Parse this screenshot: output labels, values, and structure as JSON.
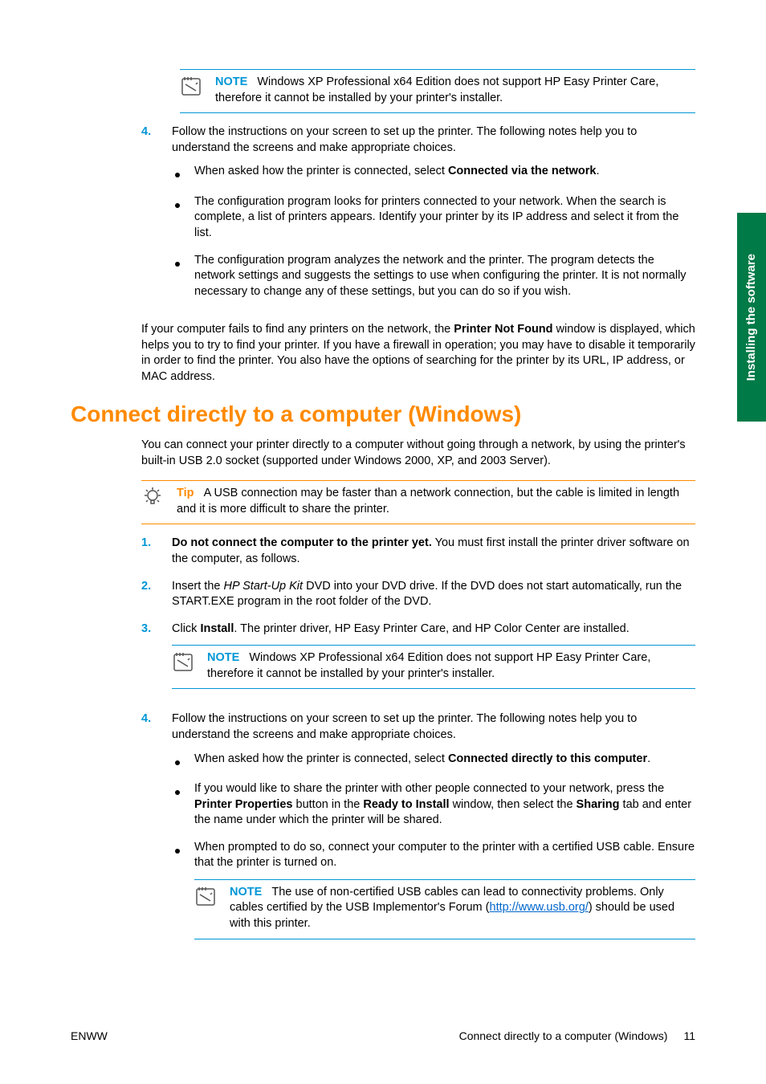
{
  "sideTab": "Installing the software",
  "noteLabel": "NOTE",
  "tipLabel": "Tip",
  "top": {
    "note1": "Windows XP Professional x64 Edition does not support HP Easy Printer Care, therefore it cannot be installed by your printer's installer.",
    "item4_num": "4.",
    "item4_text": "Follow the instructions on your screen to set up the printer. The following notes help you to understand the screens and make appropriate choices.",
    "b1_a": "When asked how the printer is connected, select ",
    "b1_b": "Connected via the network",
    "b1_c": ".",
    "b2": "The configuration program looks for printers connected to your network. When the search is complete, a list of printers appears. Identify your printer by its IP address and select it from the list.",
    "b3": "The configuration program analyzes the network and the printer. The program detects the network settings and suggests the settings to use when configuring the printer. It is not normally necessary to change any of these settings, but you can do so if you wish.",
    "closing_a": "If your computer fails to find any printers on the network, the ",
    "closing_b": "Printer Not Found",
    "closing_c": " window is displayed, which helps you to try to find your printer. If you have a firewall in operation; you may have to disable it temporarily in order to find the printer. You also have the options of searching for the printer by its URL, IP address, or MAC address."
  },
  "section": {
    "heading": "Connect directly to a computer (Windows)",
    "intro": "You can connect your printer directly to a computer without going through a network, by using the printer's built-in USB 2.0 socket (supported under Windows 2000, XP, and 2003 Server).",
    "tip": "A USB connection may be faster than a network connection, but the cable is limited in length and it is more difficult to share the printer.",
    "i1_num": "1.",
    "i1_a": "Do not connect the computer to the printer yet.",
    "i1_b": " You must first install the printer driver software on the computer, as follows.",
    "i2_num": "2.",
    "i2_a": "Insert the ",
    "i2_b": "HP Start-Up Kit",
    "i2_c": " DVD into your DVD drive. If the DVD does not start automatically, run the START.EXE program in the root folder of the DVD.",
    "i3_num": "3.",
    "i3_a": "Click ",
    "i3_b": "Install",
    "i3_c": ". The printer driver, HP Easy Printer Care, and HP Color Center are installed.",
    "note2": "Windows XP Professional x64 Edition does not support HP Easy Printer Care, therefore it cannot be installed by your printer's installer.",
    "i4_num": "4.",
    "i4_text": "Follow the instructions on your screen to set up the printer. The following notes help you to understand the screens and make appropriate choices.",
    "b1_a": "When asked how the printer is connected, select ",
    "b1_b": "Connected directly to this computer",
    "b1_c": ".",
    "b2_a": "If you would like to share the printer with other people connected to your network, press the ",
    "b2_b": "Printer Properties",
    "b2_c": " button in the ",
    "b2_d": "Ready to Install",
    "b2_e": " window, then select the ",
    "b2_f": "Sharing",
    "b2_g": " tab and enter the name under which the printer will be shared.",
    "b3": "When prompted to do so, connect your computer to the printer with a certified USB cable. Ensure that the printer is turned on.",
    "note3_a": "The use of non-certified USB cables can lead to connectivity problems. Only cables certified by the USB Implementor's Forum (",
    "note3_url": "http://www.usb.org/",
    "note3_b": ") should be used with this printer."
  },
  "footer": {
    "left": "ENWW",
    "rightText": "Connect directly to a computer (Windows)",
    "pageNum": "11"
  }
}
